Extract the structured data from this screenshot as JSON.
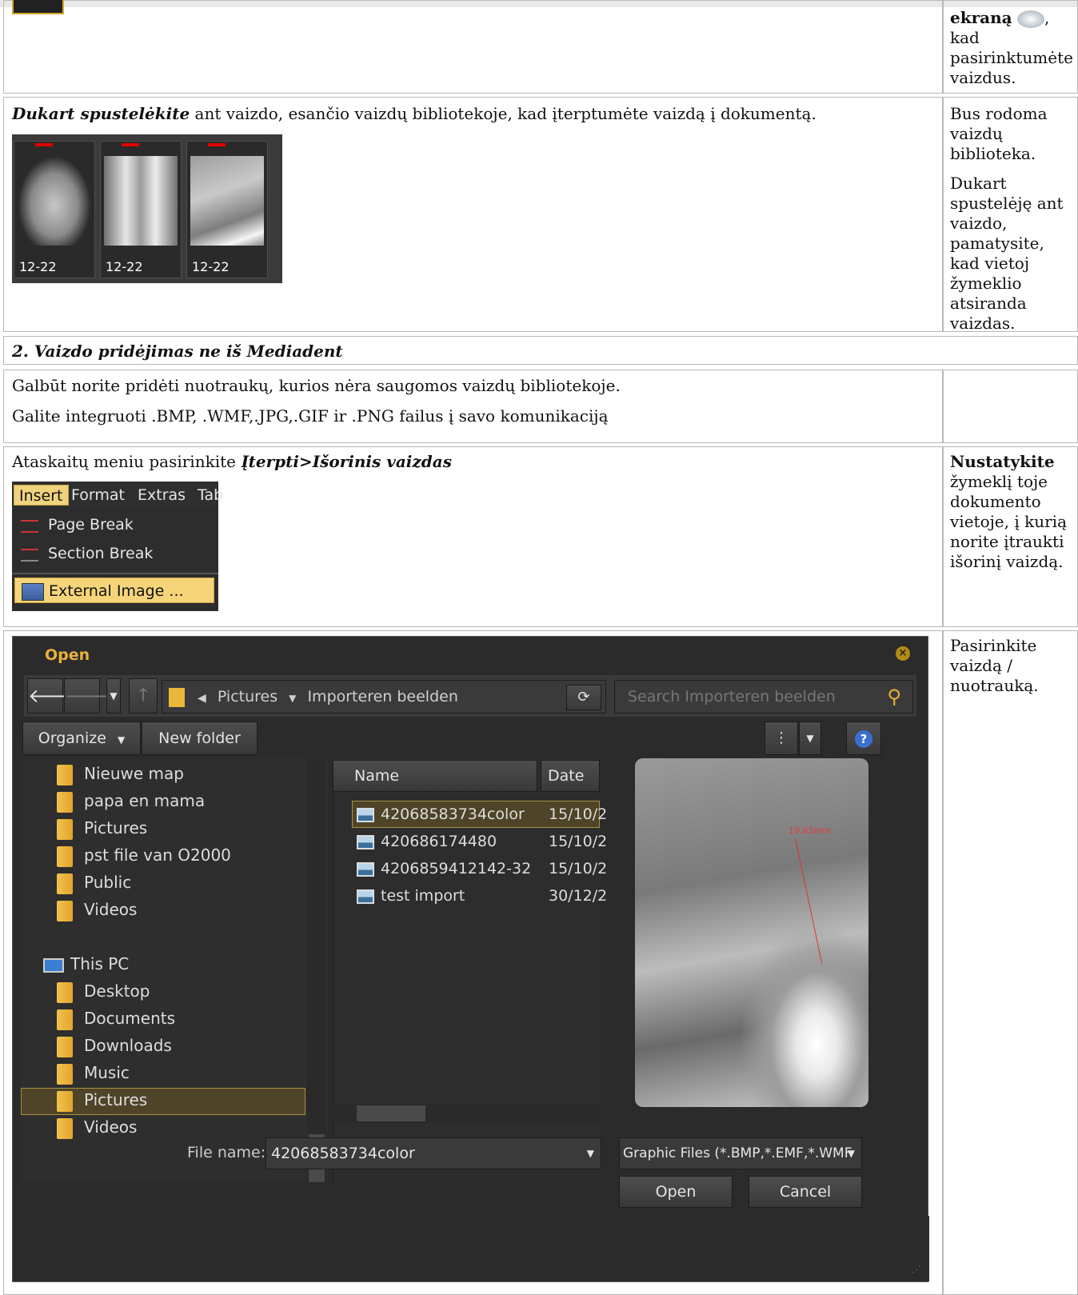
{
  "row_top": {
    "right_bold": "ekraną",
    "right_rest": "kad pasirinktumėte vaizdus.",
    "comma": ","
  },
  "row_double_click": {
    "left_bold": "Dukart spustelėkite",
    "left_rest": " ant vaizdo, esančio vaizdų bibliotekoje, kad įterptumėte vaizdą į dokumentą.",
    "thumbnails": [
      "12-22",
      "12-22",
      "12-22"
    ],
    "right_p1": "Bus rodoma vaizdų biblioteka.",
    "right_p2": "Dukart spustelėję ant vaizdo, pamatysite, kad vietoj žymeklio atsiranda vaizdas."
  },
  "section2": {
    "heading": "2. Vaizdo pridėjimas ne iš Mediadent"
  },
  "row_intro": {
    "line1": "Galbūt norite pridėti nuotraukų, kurios nėra saugomos vaizdų bibliotekoje.",
    "line2": "Galite integruoti .BMP, .WMF,.JPG,.GIF ir .PNG failus į savo komunikaciją"
  },
  "row_menu": {
    "left_text": "Ataskaitų meniu pasirinkite ",
    "left_bold": "Įterpti>Išorinis vaizdas",
    "right_bold": "Nustatykite",
    "right_rest": "žymeklį toje dokumento vietoje, į kurią norite įtraukti išorinį vaizdą.",
    "menubar": [
      "Insert",
      "Format",
      "Extras",
      "Tab"
    ],
    "items": [
      "Page Break",
      "Section Break",
      "External Image ..."
    ]
  },
  "row_dialog": {
    "right_text": "Pasirinkite vaizdą / nuotrauką.",
    "dialog": {
      "title": "Open",
      "path": [
        "Pictures",
        "Importeren beelden"
      ],
      "search_placeholder": "Search Importeren beelden",
      "organize": "Organize",
      "new_folder": "New folder",
      "tree": [
        "Nieuwe map",
        "papa en mama",
        "Pictures",
        "pst file van O2000",
        "Public",
        "Videos"
      ],
      "this_pc": "This PC",
      "pc_items": [
        "Desktop",
        "Documents",
        "Downloads",
        "Music",
        "Pictures",
        "Videos"
      ],
      "col_name": "Name",
      "col_date": "Date",
      "files": [
        {
          "name": "42068583734color",
          "date": "15/10/2"
        },
        {
          "name": "420686174480",
          "date": "15/10/2"
        },
        {
          "name": "4206859412142-32",
          "date": "15/10/2"
        },
        {
          "name": "test import",
          "date": "30/12/2"
        }
      ],
      "measure": "19,63mm",
      "filename_label": "File name:",
      "filename_value": "42068583734color",
      "filter": "Graphic Files (*.BMP,*.EMF,*.WMF",
      "open": "Open",
      "cancel": "Cancel"
    }
  }
}
